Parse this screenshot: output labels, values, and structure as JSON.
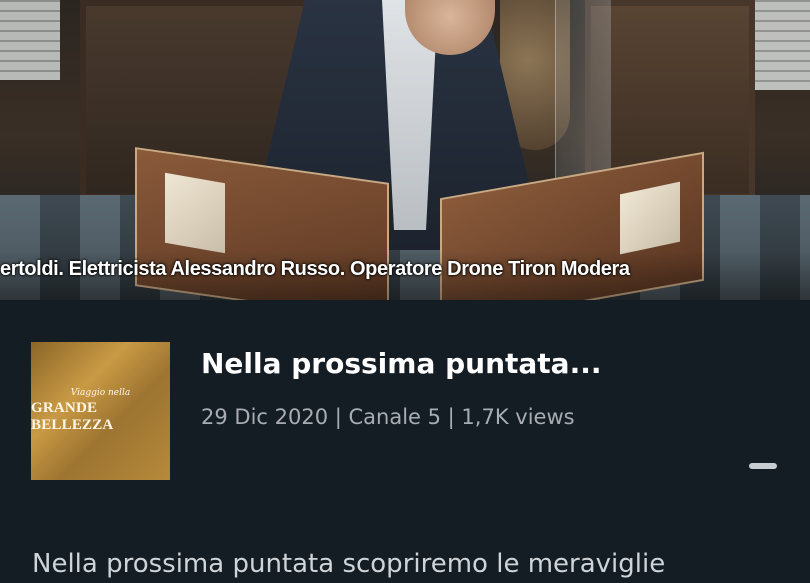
{
  "video": {
    "credits_text": "ertoldi. Elettricista Alessandro Russo. Operatore Drone Tiron Modera"
  },
  "episode": {
    "thumbnail_small_text": "Viaggio nella",
    "thumbnail_big_text": "GRANDE BELLEZZA",
    "title": "Nella prossima puntata...",
    "meta": "29 Dic 2020 | Canale 5 | 1,7K views",
    "description": "Nella prossima puntata scopriremo le meraviglie"
  }
}
